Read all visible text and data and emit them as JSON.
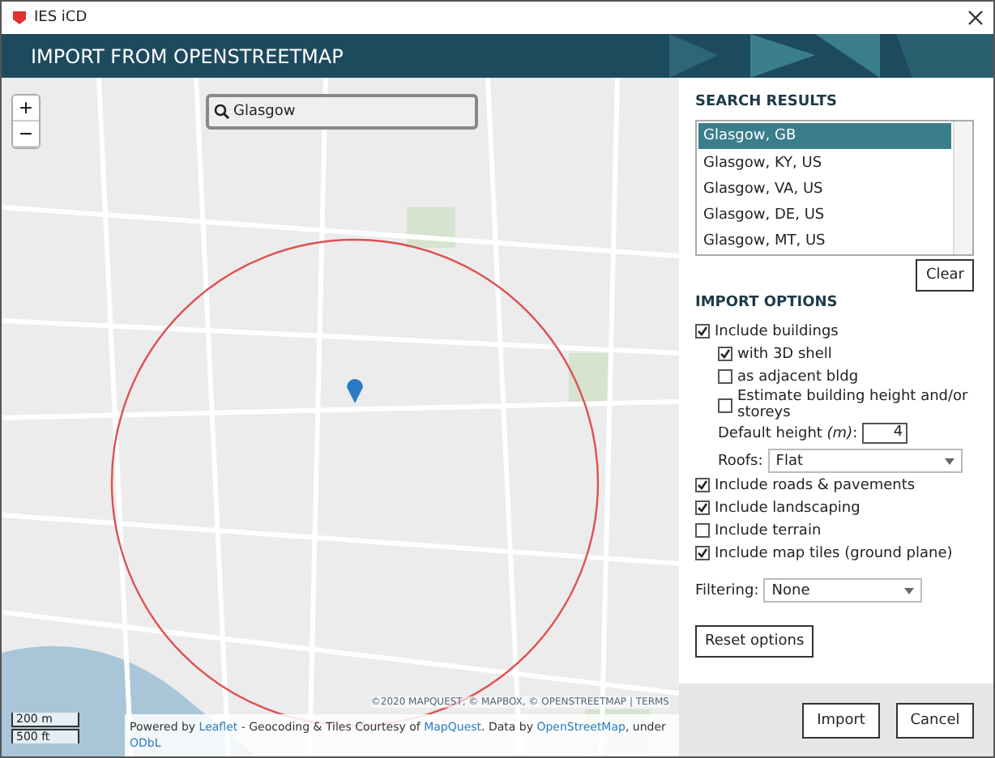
{
  "window": {
    "title": "IES iCD"
  },
  "header": {
    "title": "IMPORT FROM OPENSTREETMAP"
  },
  "map": {
    "search": {
      "value": "Glasgow"
    },
    "zoom_in": "+",
    "zoom_out": "−",
    "scale": [
      "200 m",
      "500 ft"
    ],
    "copyright": "©2020 MAPQUEST, © MAPBOX, © OPENSTREETMAP | TERMS",
    "attribution": [
      {
        "kind": "text",
        "text": "Powered by "
      },
      {
        "kind": "link",
        "text": "Leaflet"
      },
      {
        "kind": "text",
        "text": " - Geocoding & Tiles Courtesy of "
      },
      {
        "kind": "link",
        "text": "MapQuest"
      },
      {
        "kind": "text",
        "text": ". Data by "
      },
      {
        "kind": "link",
        "text": "OpenStreetMap"
      },
      {
        "kind": "text",
        "text": ", under "
      },
      {
        "kind": "link",
        "text": "ODbL"
      }
    ]
  },
  "search_results": {
    "title": "SEARCH RESULTS",
    "items": [
      {
        "label": "Glasgow, GB",
        "selected": true
      },
      {
        "label": "Glasgow, KY, US",
        "selected": false
      },
      {
        "label": "Glasgow, VA, US",
        "selected": false
      },
      {
        "label": "Glasgow, DE, US",
        "selected": false
      },
      {
        "label": "Glasgow, MT, US",
        "selected": false
      }
    ],
    "clear": "Clear"
  },
  "import_options": {
    "title": "IMPORT OPTIONS",
    "include_buildings": {
      "label": "Include buildings",
      "checked": true
    },
    "building_options": [
      {
        "label": "with 3D shell",
        "checked": true
      },
      {
        "label": "as adjacent bldg",
        "checked": false
      },
      {
        "label": "Estimate building height and/or storeys",
        "checked": false
      }
    ],
    "default_height": {
      "label": "Default height *(m)*:",
      "value": "4"
    },
    "roofs": {
      "label": "Roofs:",
      "value": "Flat"
    },
    "others": [
      {
        "label": "Include roads & pavements",
        "checked": true
      },
      {
        "label": "Include landscaping",
        "checked": true
      },
      {
        "label": "Include terrain",
        "checked": false
      },
      {
        "label": "Include map tiles (ground plane)",
        "checked": true
      }
    ],
    "filtering": {
      "label": "Filtering:",
      "value": "None"
    },
    "reset": "Reset options"
  },
  "footer": {
    "buttons": [
      "Import",
      "Cancel"
    ]
  }
}
